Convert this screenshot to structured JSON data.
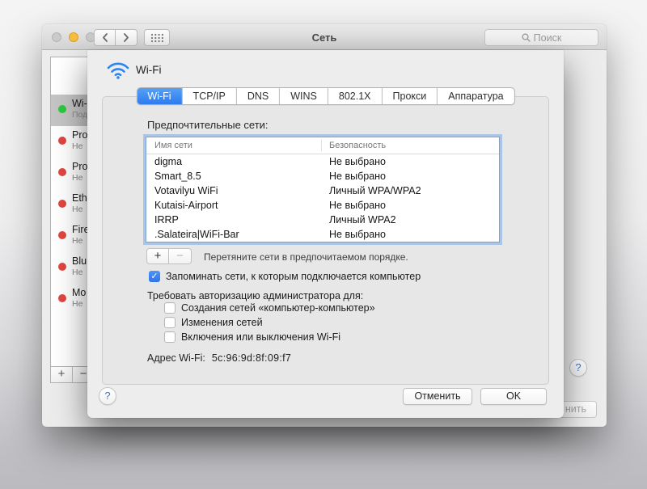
{
  "icons": {
    "check": "✓",
    "help": "?",
    "search_glyph": "⌕",
    "back_glyph": "‹",
    "forward_glyph": "›"
  },
  "colors": {
    "accent_blue": "#2d7bf0",
    "selected_tab_blue": "#3b8cf4",
    "focus_ring_blue": "#89b2e3",
    "wifi_icon_blue": "#2a86f3",
    "connected_green": "#2bc93e",
    "disconnected_red": "#e2463f",
    "minimize_yellow": "#f6be40",
    "sheet_background": "#ededed"
  },
  "window": {
    "title": "Сеть",
    "search": {
      "placeholder": "Поиск"
    },
    "sidebar": {
      "items": [
        {
          "label": "Wi-",
          "status": "Под",
          "selected": true,
          "dot_color": "#2bc93e"
        },
        {
          "label": "Pro",
          "status": "Не",
          "selected": false,
          "dot_color": "#e2463f"
        },
        {
          "label": "Pro",
          "status": "Не",
          "selected": false,
          "dot_color": "#e2463f"
        },
        {
          "label": "Eth",
          "status": "Не",
          "selected": false,
          "dot_color": "#e2463f"
        },
        {
          "label": "Fire",
          "status": "Не",
          "selected": false,
          "dot_color": "#e2463f"
        },
        {
          "label": "Blu",
          "status": "Не",
          "selected": false,
          "dot_color": "#e2463f"
        },
        {
          "label": "Mo",
          "status": "Не",
          "selected": false,
          "dot_color": "#e2463f"
        }
      ],
      "add_label": "+",
      "remove_label": "−"
    },
    "help_label": "?",
    "apply_button_fragment": "нить"
  },
  "sheet": {
    "service": {
      "name": "Wi-Fi"
    },
    "tabs": [
      {
        "label": "Wi-Fi",
        "selected": true
      },
      {
        "label": "TCP/IP",
        "selected": false
      },
      {
        "label": "DNS",
        "selected": false
      },
      {
        "label": "WINS",
        "selected": false
      },
      {
        "label": "802.1X",
        "selected": false
      },
      {
        "label": "Прокси",
        "selected": false
      },
      {
        "label": "Аппаратура",
        "selected": false
      }
    ],
    "preferred_networks_label": "Предпочтительные сети:",
    "table": {
      "columns": [
        "Имя сети",
        "Безопасность"
      ],
      "rows": [
        [
          "digma",
          "Не выбрано"
        ],
        [
          "Smart_8.5",
          "Не выбрано"
        ],
        [
          "Votavilyu WiFi",
          "Личный WPA/WPA2"
        ],
        [
          "Kutaisi-Airport",
          "Не выбрано"
        ],
        [
          "IRRP",
          "Личный WPA2"
        ],
        [
          ".Salateira|WiFi-Bar",
          "Не выбрано"
        ]
      ]
    },
    "add_label": "+",
    "remove_label": "−",
    "drag_hint": "Перетяните сети в предпочитаемом порядке.",
    "remember_networks": {
      "label": "Запоминать сети, к которым подключается компьютер",
      "checked": true
    },
    "admin_auth_label": "Требовать авторизацию администратора для:",
    "admin_options": [
      {
        "label": "Создания сетей «компьютер-компьютер»",
        "checked": false
      },
      {
        "label": "Изменения сетей",
        "checked": false
      },
      {
        "label": "Включения или выключения Wi-Fi",
        "checked": false
      }
    ],
    "wifi_address_label": "Адрес Wi-Fi:",
    "wifi_address_value": "5c:96:9d:8f:09:f7",
    "help_label": "?",
    "cancel_label": "Отменить",
    "ok_label": "OK"
  }
}
